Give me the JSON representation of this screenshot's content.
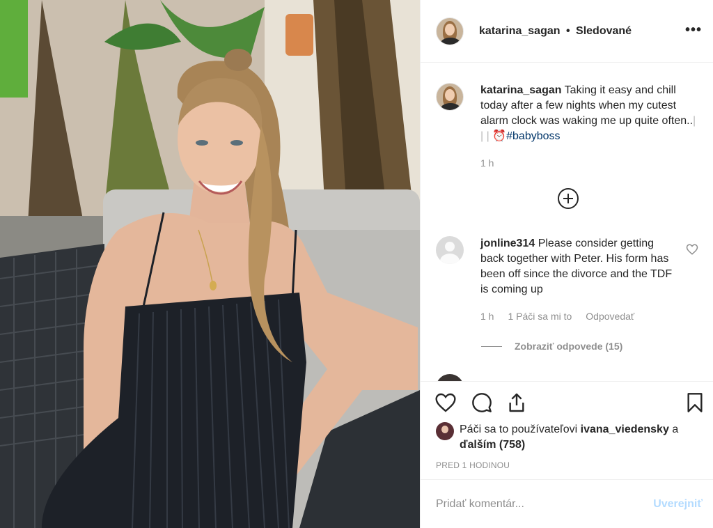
{
  "header": {
    "username": "katarina_sagan",
    "separator": "•",
    "following": "Sledované",
    "more": "•••"
  },
  "caption": {
    "username": "katarina_sagan",
    "text": "Taking it easy and chill today after a few nights when my cutest alarm clock was waking me up quite often..",
    "emoji": "| | | ⏰",
    "hashtag": "#babyboss",
    "time": "1 h"
  },
  "load_more": "⊕",
  "comment": {
    "username": "jonline314",
    "text": "Please consider getting back together with Peter. His form has been off since the divorce and the TDF is coming up",
    "time": "1 h",
    "likes": "1 Páči sa mi to",
    "reply": "Odpovedať",
    "view_replies": "Zobraziť odpovede (15)"
  },
  "likes": {
    "prefix": "Páči sa to používateľovi",
    "user": "ivana_viedensky",
    "mid": "a",
    "others": "ďalším (758)"
  },
  "posted": "PRED 1 HODINOU",
  "add_comment": {
    "placeholder": "Pridať komentár...",
    "post": "Uverejniť"
  },
  "icons": [
    "heart-icon",
    "comment-icon",
    "share-icon",
    "bookmark-icon",
    "more-icon",
    "plus-circle-icon"
  ],
  "colors": {
    "link": "#003569",
    "muted": "#8e8e8e",
    "post_disabled": "#b3dbff"
  }
}
